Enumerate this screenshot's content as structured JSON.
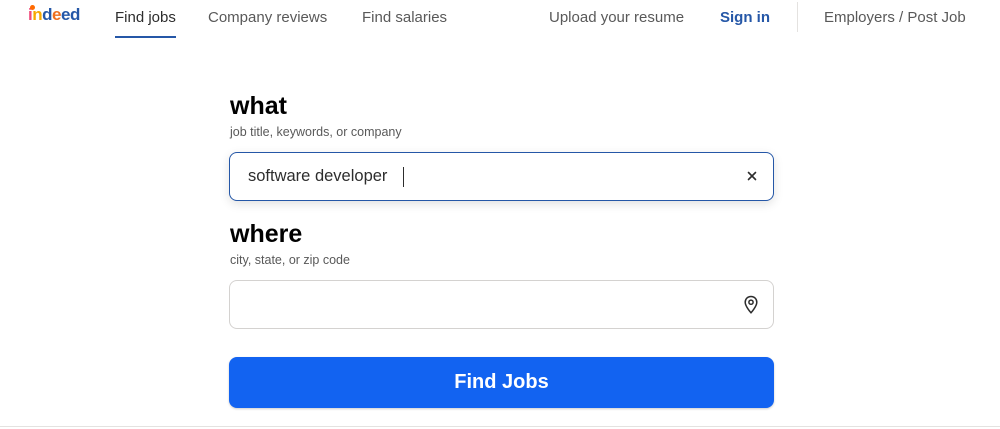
{
  "header": {
    "logo_text": "indeed",
    "nav": {
      "find_jobs": "Find jobs",
      "company_reviews": "Company reviews",
      "find_salaries": "Find salaries",
      "upload_resume": "Upload your resume",
      "sign_in": "Sign in",
      "employers": "Employers / Post Job"
    }
  },
  "search": {
    "what": {
      "title": "what",
      "hint": "job title, keywords, or company",
      "value": "software developer",
      "clear_icon": "close-icon"
    },
    "where": {
      "title": "where",
      "hint": "city, state, or zip code",
      "value": "",
      "location_icon": "map-pin-icon"
    },
    "submit_label": "Find Jobs"
  },
  "colors": {
    "brand_blue": "#2557a7",
    "button_blue": "#1263f1"
  }
}
